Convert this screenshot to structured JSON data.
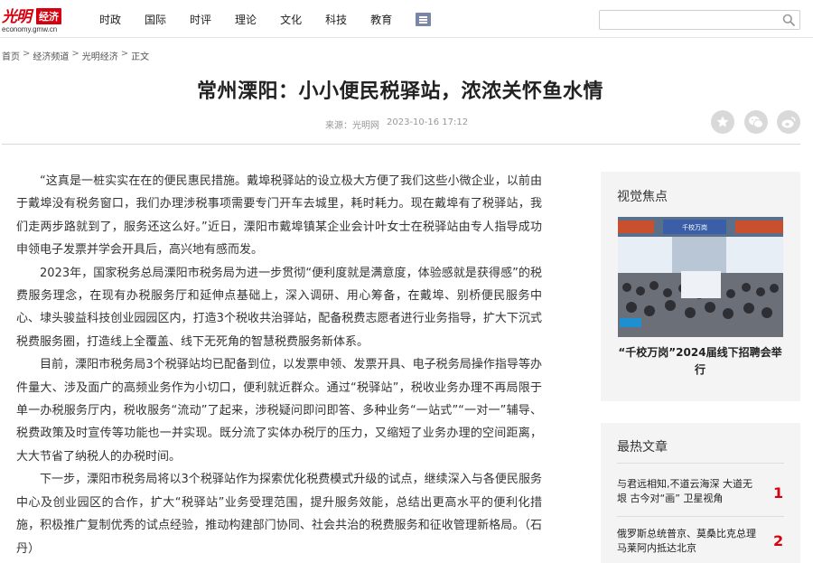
{
  "header": {
    "logo_text": "光明",
    "logo_badge": "经济",
    "logo_sub": "economy.gmw.cn",
    "nav": [
      "时政",
      "国际",
      "时评",
      "理论",
      "文化",
      "科技",
      "教育"
    ],
    "search_placeholder": ""
  },
  "breadcrumb": [
    "首页",
    "经济频道",
    "光明经济",
    "正文"
  ],
  "article": {
    "title": "常州溧阳：小小便民税驿站，浓浓关怀鱼水情",
    "source": "来源：光明网",
    "datetime": "2023-10-16 17:12",
    "paragraphs": [
      "“这真是一桩实实在在的便民惠民措施。戴埠税驿站的设立极大方便了我们这些小微企业，以前由于戴埠没有税务窗口，我们办理涉税事项需要专门开车去城里，耗时耗力。现在戴埠有了税驿站，我们走两步路就到了，服务还这么好。”近日，溧阳市戴埠镇某企业会计叶女士在税驿站由专人指导成功申领电子发票并学会开具后，高兴地有感而发。",
      "2023年，国家税务总局溧阳市税务局为进一步贯彻“便利度就是满意度，体验感就是获得感”的税费服务理念，在现有办税服务厅和延伸点基础上，深入调研、用心筹备，在戴埠、别桥便民服务中心、埭头骏益科技创业园园区内，打造3个税收共治驿站，配备税费志愿者进行业务指导，扩大下沉式税费服务圈，打造线上全覆盖、线下无死角的智慧税费服务新体系。",
      "目前，溧阳市税务局3个税驿站均已配备到位，以发票申领、发票开具、电子税务局操作指导等办件量大、涉及面广的高频业务作为小切口，便利就近群众。通过“税驿站”，税收业务办理不再局限于单一办税服务厅内，税收服务“流动”了起来，涉税疑问即问即答、多种业务“一站式”“一对一”辅导、税费政策及时宣传等功能也一并实现。既分流了实体办税厅的压力，又缩短了业务办理的空间距离，大大节省了纳税人的办税时间。",
      "下一步，溧阳市税务局将以3个税驿站作为探索优化税费模式升级的试点，继续深入与各便民服务中心及创业园区的合作，扩大“税驿站”业务受理范围，提升服务效能，总结出更高水平的便利化措施，积极推广复制优秀的试点经验，推动构建部门协同、社会共治的税费服务和征收管理新格局。（石丹）"
    ]
  },
  "sidebar": {
    "focus_title": "视觉焦点",
    "focus_banner_text": "千校万岗",
    "focus_caption": "“千校万岗”2024届线下招聘会举行",
    "hot_title": "最热文章",
    "hot_items": [
      {
        "text": "与君远相知,不道云海深 大道无垠 古今对“画” 卫星视角",
        "rank": "1"
      },
      {
        "text": "俄罗斯总统普京、莫桑比克总理马莱阿内抵达北京",
        "rank": "2"
      }
    ]
  },
  "colors": {
    "brand_red": "#d7000f",
    "sidebar_bg": "#f4f4f4",
    "share_icon_bg": "#d9d9d9"
  }
}
